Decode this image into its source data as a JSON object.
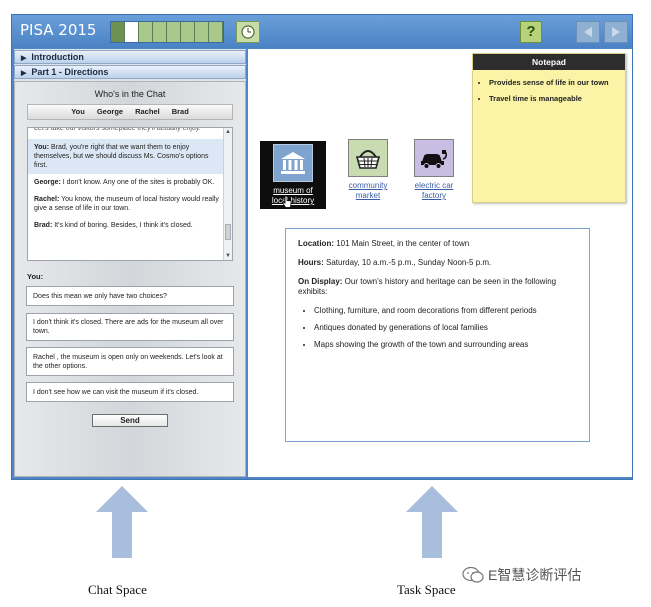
{
  "app": {
    "title": "PISA 2015",
    "progress": {
      "total": 8,
      "done": 1,
      "current_index": 1
    },
    "help_label": "?"
  },
  "sections": {
    "introduction": "Introduction",
    "directions": "Part 1 - Directions"
  },
  "chat": {
    "title": "Who's in the Chat",
    "participants": [
      "You",
      "George",
      "Rachel",
      "Brad"
    ],
    "log_cutoff": "Let's take our visitors someplace they'll actually enjoy.",
    "messages": [
      {
        "speaker": "You:",
        "text": "Brad, you're right that we want them to enjoy themselves, but we should discuss Ms. Cosmo's options first."
      },
      {
        "speaker": "George:",
        "text": "I don't know. Any one of the sites is probably OK."
      },
      {
        "speaker": "Rachel:",
        "text": "You know, the museum of local history would really give a sense of life in our town."
      },
      {
        "speaker": "Brad:",
        "text": "It's kind of boring. Besides, I think it's closed."
      }
    ],
    "you_label": "You:",
    "options": [
      "Does this mean we only have two choices?",
      "I don't think it's closed. There are ads for the museum all over town.",
      "Rachel , the museum is open only on weekends. Let's look at the other options.",
      "I don't see how we can visit the museum if it's closed."
    ],
    "send_label": "Send"
  },
  "task": {
    "tiles": [
      {
        "label_line1": "museum of",
        "label_line2": "local history",
        "icon": "museum-icon"
      },
      {
        "label_line1": "community",
        "label_line2": "market",
        "icon": "basket-icon"
      },
      {
        "label_line1": "electric car",
        "label_line2": "factory",
        "icon": "electric-car-icon"
      }
    ],
    "notepad": {
      "title": "Notepad",
      "items": [
        "Provides sense of life in our town",
        "Travel time is manageable"
      ]
    },
    "details": {
      "location_label": "Location:",
      "location_value": " 101 Main Street, in the center of town",
      "hours_label": "Hours:",
      "hours_value": " Saturday, 10 a.m.-5 p.m., Sunday Noon-5 p.m.",
      "display_label": "On Display:",
      "display_value": " Our town's history and heritage can be seen in the following exhibits:",
      "exhibits": [
        "Clothing, furniture, and room decorations from different periods",
        "Antiques donated by generations of local families",
        "Maps showing the growth of the town and surrounding areas"
      ]
    }
  },
  "captions": {
    "chat_space": "Chat Space",
    "task_space": "Task Space",
    "watermark": "E智慧诊断评估"
  },
  "colors": {
    "frame": "#4f86c6",
    "arrow": "#a9bedc",
    "selected_tile": "#0d0d0d"
  }
}
